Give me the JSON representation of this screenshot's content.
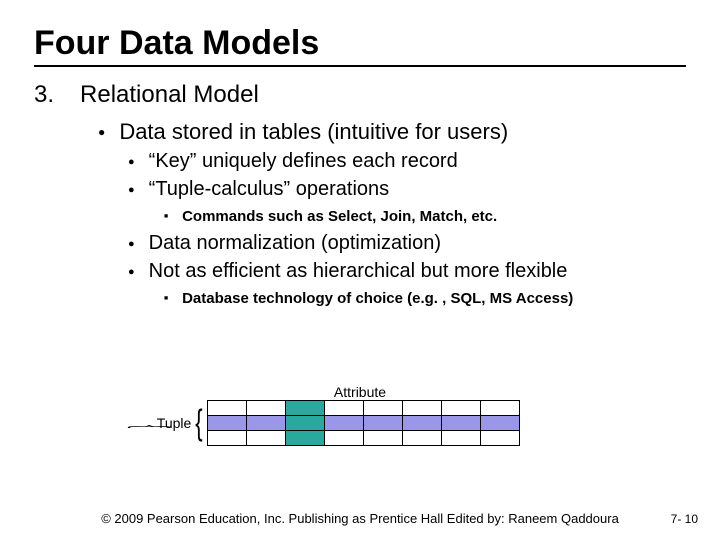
{
  "title": "Four Data Models",
  "list_number": "3.",
  "heading": "Relational Model",
  "level1": "Data stored in tables (intuitive for users)",
  "level2a": "“Key” uniquely defines each record",
  "level2b": "“Tuple-calculus” operations",
  "level3a": "Commands such as Select, Join, Match, etc.",
  "level2c": "Data normalization (optimization)",
  "level2d": "Not as efficient as hierarchical but more flexible",
  "level3b": "Database technology of choice (e.g. , SQL, MS Access)",
  "diagram": {
    "attribute_label": "Attribute",
    "tuple_label": "Tuple"
  },
  "footer": {
    "copyright": "© 2009 Pearson Education, Inc. Publishing as Prentice Hall Edited by: Raneem Qaddoura",
    "page": "7- 10"
  }
}
